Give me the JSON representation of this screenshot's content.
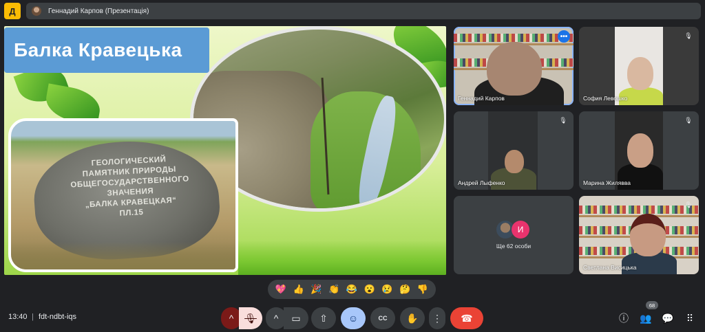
{
  "header": {
    "app_icon_label": "Д",
    "presenter_title": "Геннадий Карпов (Презентація)"
  },
  "slide": {
    "title": "Балка Кравецька",
    "rock_inscription": [
      "Геологический",
      "памятник природы",
      "общегосударственного",
      "значения",
      "„Балка Кравецкая“",
      "Пл.15"
    ]
  },
  "participants": [
    {
      "name": "Геннадий Карпов",
      "speaking": true,
      "muted": false
    },
    {
      "name": "София Левошко",
      "speaking": false,
      "muted": true
    },
    {
      "name": "Андрей Лыфенко",
      "speaking": false,
      "muted": true
    },
    {
      "name": "Марина Жилявва",
      "speaking": false,
      "muted": true
    },
    {
      "name": "Светлана Висицька",
      "speaking": false,
      "muted": true
    }
  ],
  "overflow": {
    "letter": "И",
    "text": "Ще 62 особи"
  },
  "reactions": [
    "💖",
    "👍",
    "🎉",
    "👏",
    "😂",
    "😮",
    "😢",
    "🤔",
    "👎"
  ],
  "bottom": {
    "time": "13:40",
    "separator": "|",
    "meeting_code": "fdt-ndbt-iqs",
    "participant_count": "68"
  },
  "icons": {
    "more": "•••",
    "mic_off": "🎙",
    "chevron_up": "^",
    "camera": "▭",
    "present": "⇧",
    "emoji": "☺",
    "captions": "CC",
    "hand": "✋",
    "more_vert": "⋮",
    "hangup": "☎",
    "info": "ⓘ",
    "people": "👥",
    "chat": "💬",
    "apps": "⠿"
  },
  "colors": {
    "accent_blue": "#8ab4f8",
    "hangup_red": "#ea4335",
    "title_box": "#5b9bd5"
  }
}
